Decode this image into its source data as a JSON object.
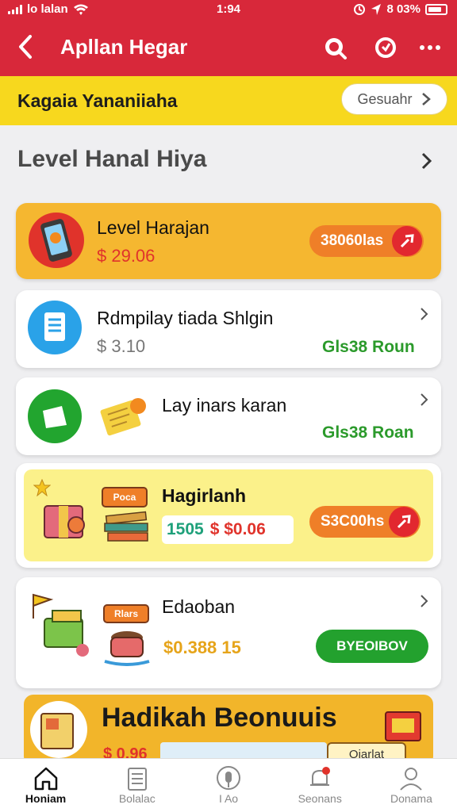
{
  "status": {
    "carrier": "lo lalan",
    "time": "1:94",
    "battery": "8 03%"
  },
  "appbar": {
    "title": "Apllan Hegar"
  },
  "banner": {
    "text": "Kagaia Yananiiaha",
    "button": "Gesuahr"
  },
  "section": {
    "title": "Level Hanal Hiya"
  },
  "cards": [
    {
      "name": "Level Harajan",
      "price": "$ 29.06",
      "action": "38060las"
    },
    {
      "name": "Rdmpilay tiada Shlgin",
      "price": "$ 3.10",
      "link": "Gls38 Roun"
    },
    {
      "name": "Lay inars karan",
      "link": "Gls38 Roan"
    },
    {
      "name": "Hagirlanh",
      "badge": "Poca",
      "price_a": "1505",
      "price_b": "$ $0.06",
      "action": "S3C00hs"
    },
    {
      "name": "Edaoban",
      "badge": "Rlars",
      "price": "$0.388 15",
      "button": "BYEOIBOV"
    }
  ],
  "promo": {
    "title": "Hadikah Beonuuis",
    "price": "$ 0.96",
    "button": "Oiarlat"
  },
  "tabs": [
    {
      "label": "Honiam",
      "icon": "home-icon"
    },
    {
      "label": "Bolalac",
      "icon": "list-icon"
    },
    {
      "label": "I Ao",
      "icon": "mic-icon"
    },
    {
      "label": "Seonans",
      "icon": "bell-icon"
    },
    {
      "label": "Donama",
      "icon": "person-icon"
    }
  ],
  "colors": {
    "red": "#d8283a",
    "yellow": "#f7d81e",
    "orange": "#f4b62b",
    "green": "#2b9a2b"
  }
}
